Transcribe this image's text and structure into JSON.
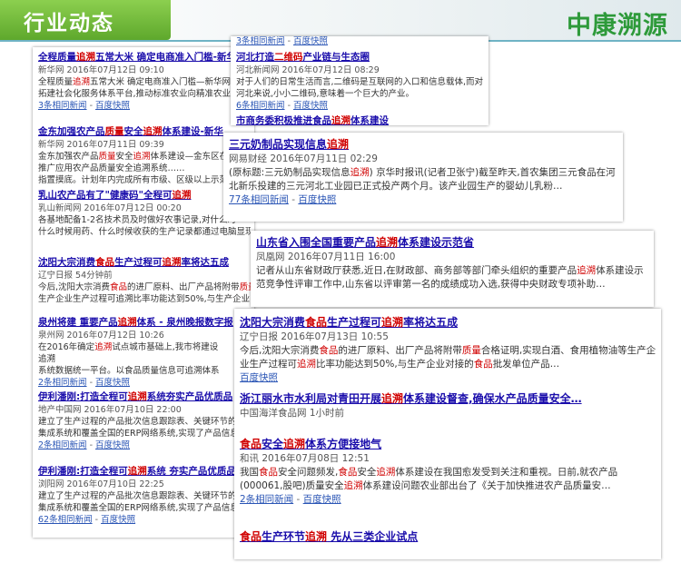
{
  "header": {
    "tab_title": "行业动态",
    "logo": "中康溯源"
  },
  "left": [
    {
      "title": [
        "全程质量",
        "追溯",
        "五常大米 确定电商准入门槛-新华"
      ],
      "hl": [
        1
      ],
      "meta": "新华网 2016年07月12日 09:10",
      "snippet": [
        "全程质量",
        "追溯",
        "五常大米 确定电商准入门槛—新华网",
        "推行",
        "质量追溯",
        "机制,摸索出了一套五常大米",
        "质量",
        "追溯",
        ""
      ],
      "shl": [
        1,
        3,
        5
      ],
      "snippet2": "拓建社会化服务体系平台,推动标准农业向精准农业转",
      "links": [
        "3条相同新闻",
        "百度快照"
      ]
    },
    {
      "title": [
        "金东加强农产品",
        "质量",
        "安全",
        "追溯",
        "体系建设-新华"
      ],
      "hl": [
        1,
        3
      ],
      "meta": "新华网 2016年07月11日 09:39",
      "snippet": [
        "金东加强农产品",
        "质量",
        "安全",
        "追溯",
        "体系建设—金东区在萍"
      ],
      "shl": [
        1,
        3
      ],
      "snippet2": "推广应用农产品质量安全追溯系统……",
      "extra": "指置摸底。计划年内完成所有市级、区级以上示范",
      "links": []
    },
    {
      "title": [
        "乳山农产品有了\"健康码\"全程可",
        "追溯",
        ""
      ],
      "hl": [
        1
      ],
      "meta": "乳山新闻网 2016年07月12日 00:20",
      "snippet": [
        "各基地配备1-2名技术员及时做好农事记录,对什么时"
      ],
      "shl": [],
      "snippet2": "什么时候用药、什么时候收获的生产记录都通过电脑显现",
      "links": []
    },
    {
      "title": [
        "沈阳大宗消费",
        "食品",
        "生产过程可",
        "追溯",
        "率将达五成"
      ],
      "hl": [
        1,
        3
      ],
      "meta": "辽宁日报 54分钟前",
      "snippet": [
        "今后,沈阳大宗消费",
        "食品",
        "的进厂原料、出厂产品将附带",
        "质量",
        "合格证"
      ],
      "shl": [
        1,
        3
      ],
      "snippet2": "生产企业生产过程可追溯比率功能达到50%,与生产企业",
      "links": []
    },
    {
      "title": [
        "泉州将建 重要产品",
        "追溯",
        "体系 - 泉州晚报数字报"
      ],
      "hl": [
        1
      ],
      "meta": "泉州网 2016年07月12日 10:26",
      "snippet": [
        "在2016年确定",
        "追溯",
        "试点城市基础上,我市将建设"
      ],
      "shl": [
        1
      ],
      "snippet2": "追溯",
      "extra": "系统数据统一平台。以食品质量信息可追溯体系",
      "links": [
        "2条相同新闻",
        "百度快照"
      ]
    },
    {
      "title": [
        "伊利潘刚:打造全程可",
        "追溯",
        "系统夯实产品优质品"
      ],
      "hl": [
        1
      ],
      "meta": "地产中国网 2016年07月10日 22:00",
      "snippet": [
        "建立了生产过程的产品批次信息跟踪表、关键环节的"
      ],
      "shl": [],
      "snippet2": "集成系统和覆盖全国的ERP网络系统,实现了产品信息…",
      "links": [
        "2条相同新闻",
        "百度快照"
      ]
    },
    {
      "title": [
        "伊利潘刚:打造全程可",
        "追溯",
        "系统 夯实产品优质品"
      ],
      "hl": [
        1
      ],
      "meta": "浏阳网 2016年07月10日 22:25",
      "snippet": [
        "建立了生产过程的产品批次信息跟踪表、关键环节的"
      ],
      "shl": [],
      "snippet2": "集成系统和覆盖全国的ERP网络系统,实现了产品信息可",
      "links": [
        "62条相同新闻",
        "百度快照"
      ]
    }
  ],
  "topright": [
    {
      "links": [
        "3条相同新闻",
        "百度快照"
      ]
    },
    {
      "title": [
        "河北打造",
        "二维码",
        "产业链与生态圈"
      ],
      "hl": [
        1
      ],
      "meta": "河北新闻网 2016年07月12日 08:29",
      "snippet": "对于人们的日常生活而言,二维码是互联网的入口和信息载体,而对河北来说,小小二维码,意味着一个巨大的产业。",
      "links": [
        "6条相同新闻",
        "百度快照"
      ]
    },
    {
      "title": [
        "市商务委积极推进食品",
        "追溯",
        "体系建设"
      ],
      "hl": [
        1
      ]
    }
  ],
  "mid1": {
    "title": [
      "三元奶制品实现信息",
      "追溯",
      ""
    ],
    "hl": [
      1
    ],
    "meta": "网易财经 2016年07月11日 02:29",
    "snippet": [
      "(原标题:三元奶制品实现信息",
      "追溯",
      ") 京华时报讯(记者卫张宁)截至昨天,首农集团三元食品在河北新乐投建的三元河北工业园已正式投产两个月。该产业园生产的婴幼儿乳粉…"
    ],
    "shl": [
      1
    ],
    "links": [
      "77条相同新闻",
      "百度快照"
    ]
  },
  "mid2": {
    "title": [
      "山东省入围全国重要产品",
      "追溯",
      "体系建设示范省"
    ],
    "hl": [
      1
    ],
    "meta": "凤凰网 2016年07月11日 16:00",
    "snippet": [
      "记者从山东省财政厅获悉,近日,在财政部、商务部等部门牵头组织的重要产品",
      "追溯",
      "体系建设示范竞争性评审工作中,山东省以评审第一名的成绩成功入选,获得中央财政专项补助…"
    ],
    "shl": [
      1
    ]
  },
  "bottom": [
    {
      "title": [
        "沈阳大宗消费",
        "食品",
        "生产过程可",
        "追溯",
        "率将达五成"
      ],
      "hl": [
        1,
        3
      ],
      "meta": "辽宁日报 2016年07月13日 10:55",
      "snippet": [
        "今后,沈阳大宗消费",
        "食品",
        "的进厂原料、出厂产品将附带",
        "质量",
        "合格证明,实现白酒、食用植物油等生产企业生产过程可",
        "追溯",
        "比率功能达到50%,与生产企业对接的",
        "食品",
        "批发单位产品…"
      ],
      "shl": [
        1,
        3,
        5,
        7
      ],
      "links": [
        "百度快照"
      ]
    },
    {
      "title": [
        "浙江丽水市水利局对青田开展",
        "追溯",
        "体系建设督查,确保水产品质量安全…"
      ],
      "hl": [
        1
      ],
      "meta": "中国海洋食品网 1小时前"
    },
    {
      "title": [
        "食品",
        "安全",
        "追溯",
        "体系",
        "方便",
        "接地气"
      ],
      "hl": [
        0,
        2
      ],
      "meta": "和讯 2016年07月08日 12:51",
      "snippet": [
        "我国",
        "食品",
        "安全问题频发,",
        "食品",
        "安全",
        "追溯",
        "体系建设在我国愈发受到关注和重视。日前,就农产品(000061,股吧)质量安全",
        "追溯",
        "体系建设问题农业部出台了《关于加快推进农产品质量安…"
      ],
      "shl": [
        1,
        3,
        5,
        7
      ],
      "links": [
        "2条相同新闻",
        "百度快照"
      ]
    },
    {
      "title": [
        "食品",
        "生产环节",
        "追溯",
        " 先从三类企业试点"
      ],
      "hl": [
        0,
        2
      ]
    }
  ]
}
